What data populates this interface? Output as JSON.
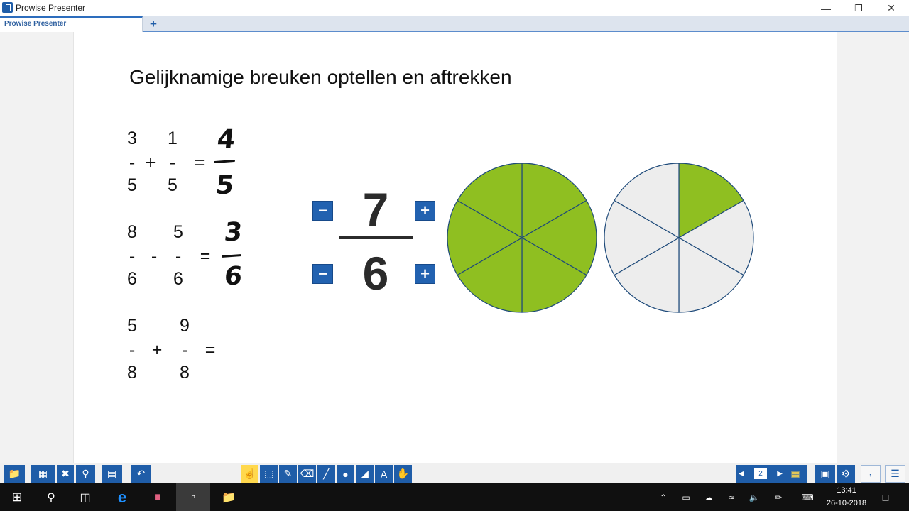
{
  "window": {
    "title": "Prowise Presenter",
    "minimize": "—",
    "restore": "❐",
    "close": "✕"
  },
  "tabs": {
    "active_label": "Prowise Presenter",
    "add_label": "+"
  },
  "slide": {
    "title": "Gelijknamige breuken optellen en aftrekken",
    "equations": [
      {
        "n1": "3",
        "op": "+",
        "n2": "1",
        "d1": "5",
        "d2": "5",
        "eq": "=",
        "bar": "-",
        "answer_num": "4",
        "answer_den": "5"
      },
      {
        "n1": "8",
        "op": "-",
        "n2": "5",
        "d1": "6",
        "d2": "6",
        "eq": "=",
        "bar": "-",
        "answer_num": "3",
        "answer_den": "6"
      },
      {
        "n1": "5",
        "op": "+",
        "n2": "9",
        "d1": "8",
        "d2": "8",
        "eq": "=",
        "bar": "-"
      }
    ],
    "fraction_widget": {
      "numerator": "7",
      "denominator": "6",
      "minus_label": "−",
      "plus_label": "+",
      "fill_color": "#8fbf21",
      "empty_color": "#ededed",
      "line_color": "#1e4a7a",
      "pie1_filled_slices": 6,
      "pie2_filled_slices": 1,
      "slices_per_pie": 6
    }
  },
  "toolbar": {
    "page_number": "2",
    "prev": "◀",
    "next": "▶"
  },
  "taskbar": {
    "time": "13:41",
    "date": "26-10-2018"
  }
}
